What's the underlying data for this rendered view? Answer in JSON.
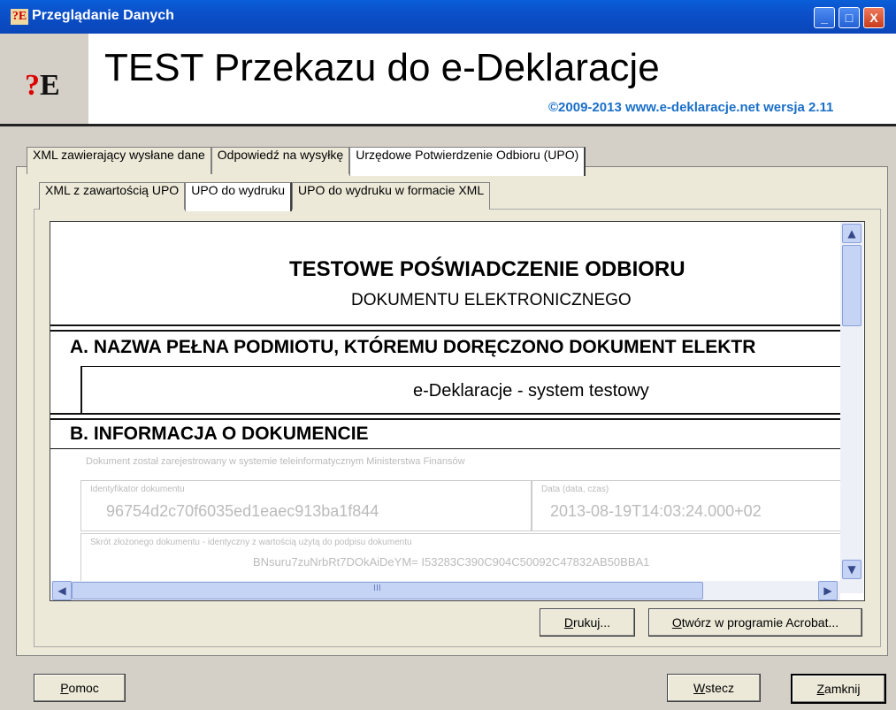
{
  "window": {
    "icon_text": "?E",
    "title": "Przeglądanie Danych",
    "minimize_glyph": "_",
    "maximize_glyph": "□",
    "close_glyph": "X"
  },
  "header": {
    "logo_q": "?",
    "logo_e": "E",
    "title": "TEST Przekazu do e-Deklaracje",
    "subtitle": "©2009-2013 www.e-deklaracje.net wersja 2.11"
  },
  "tabs": [
    {
      "label": "XML zawierający wysłane dane"
    },
    {
      "label": "Odpowiedź na wysyłkę"
    },
    {
      "label": "Urzędowe Potwierdzenie Odbioru (UPO)"
    }
  ],
  "subtabs": [
    {
      "label": "XML z zawartością UPO"
    },
    {
      "label": "UPO do wydruku"
    },
    {
      "label": "UPO do wydruku w formacie XML"
    }
  ],
  "document": {
    "title": "TESTOWE POŚWIADCZENIE ODBIORU",
    "subtitle": "DOKUMENTU ELEKTRONICZNEGO",
    "section_a": "A. NAZWA PEŁNA PODMIOTU, KTÓREMU DORĘCZONO DOKUMENT ELEKTR",
    "section_a_value": "e-Deklaracje - system testowy",
    "section_b": "B. INFORMACJA O DOKUMENCIE",
    "b_note": "Dokument został zarejestrowany w systemie teleinformatycznym Ministerstwa Finansów",
    "b_id_label": "Identyfikator dokumentu",
    "b_id_value": "96754d2c70f6035ed1eaec913ba1f844",
    "b_date_label": "Data (data, czas)",
    "b_date_value": "2013-08-19T14:03:24.000+02",
    "b_hash_label": "Skrót złożonego dokumentu - identyczny z wartością użytą do podpisu dokumentu",
    "b_hash_value": "BNsuru7zuNrbRt7DOkAiDeYM= I53283C390C904C50092C47832AB50BBA1"
  },
  "scroll": {
    "up": "▲",
    "down": "▼",
    "left": "◀",
    "right": "▶",
    "grip": "III"
  },
  "buttons": {
    "print_u": "D",
    "print_rest": "rukuj...",
    "acrobat_u": "O",
    "acrobat_rest": "twórz w programie Acrobat...",
    "help_u": "P",
    "help_rest": "omoc",
    "back_u": "W",
    "back_rest": "stecz",
    "close_u": "Z",
    "close_rest": "amknij"
  }
}
